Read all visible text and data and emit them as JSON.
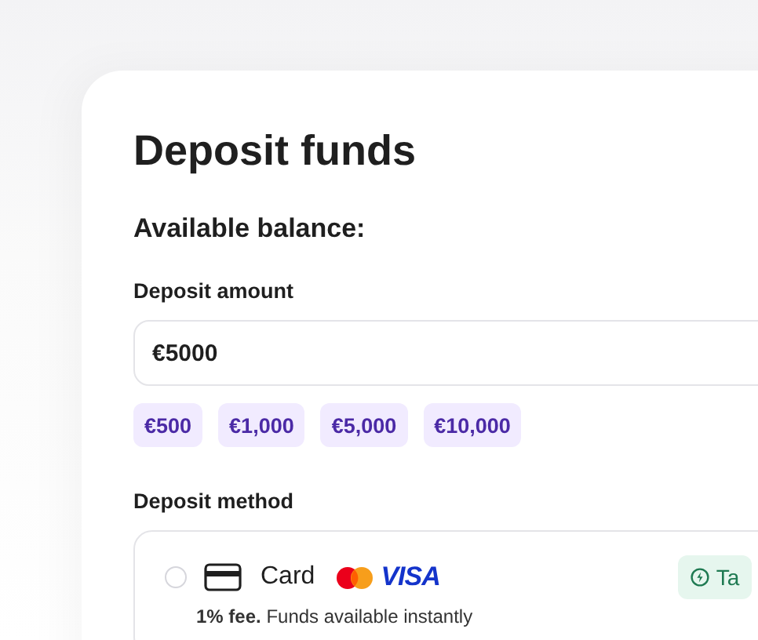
{
  "title": "Deposit funds",
  "balance": {
    "label": "Available balance:"
  },
  "amount": {
    "label": "Deposit amount",
    "value": "€5000"
  },
  "presets": [
    {
      "label": "€500"
    },
    {
      "label": "€1,000"
    },
    {
      "label": "€5,000"
    },
    {
      "label": "€10,000"
    }
  ],
  "method": {
    "label": "Deposit method",
    "options": [
      {
        "name": "Card",
        "selected": false,
        "brand": "VISA",
        "badge": "Ta",
        "note": "**1% fee.** Funds available instantly"
      }
    ]
  }
}
